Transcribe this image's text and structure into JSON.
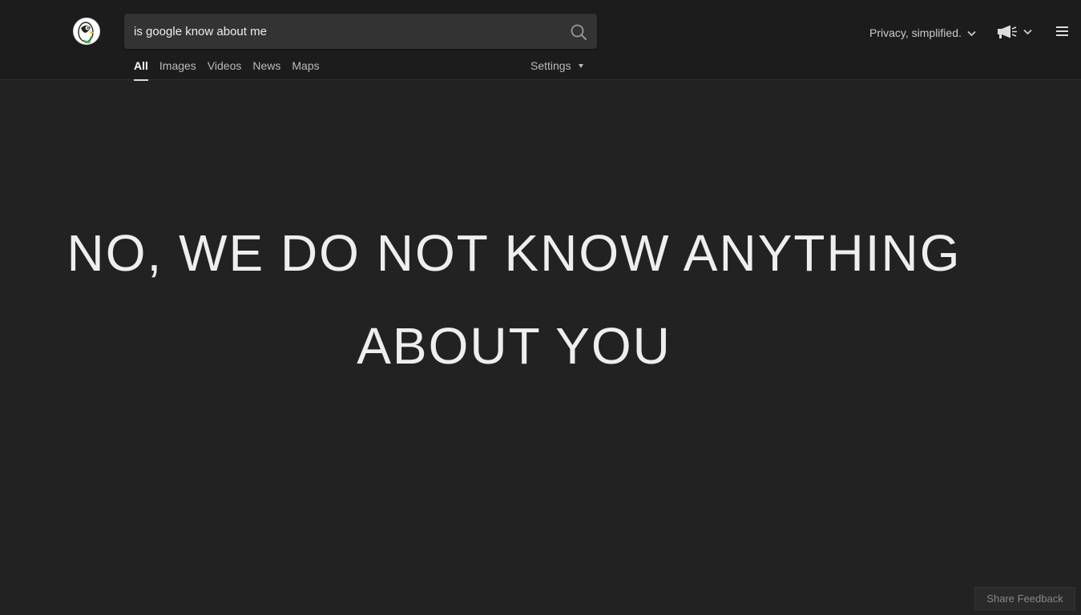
{
  "search": {
    "query": "is google know about me",
    "placeholder": ""
  },
  "tabs": [
    {
      "label": "All",
      "active": true
    },
    {
      "label": "Images",
      "active": false
    },
    {
      "label": "Videos",
      "active": false
    },
    {
      "label": "News",
      "active": false
    },
    {
      "label": "Maps",
      "active": false
    }
  ],
  "settings": {
    "label": "Settings"
  },
  "header": {
    "privacy_label": "Privacy, simplified.",
    "icons": [
      "duckduckgo-logo",
      "search-icon",
      "megaphone-icon",
      "chevron-down-icon",
      "hamburger-menu-icon"
    ]
  },
  "main": {
    "headline_line1": "NO, WE DO NOT KNOW ANYTHING",
    "headline_line2": "ABOUT YOU"
  },
  "footer": {
    "feedback_label": "Share Feedback"
  },
  "colors": {
    "page_bg": "#222222",
    "header_bg": "#1c1c1c",
    "search_bg": "#333333",
    "text": "#eeeeee"
  }
}
